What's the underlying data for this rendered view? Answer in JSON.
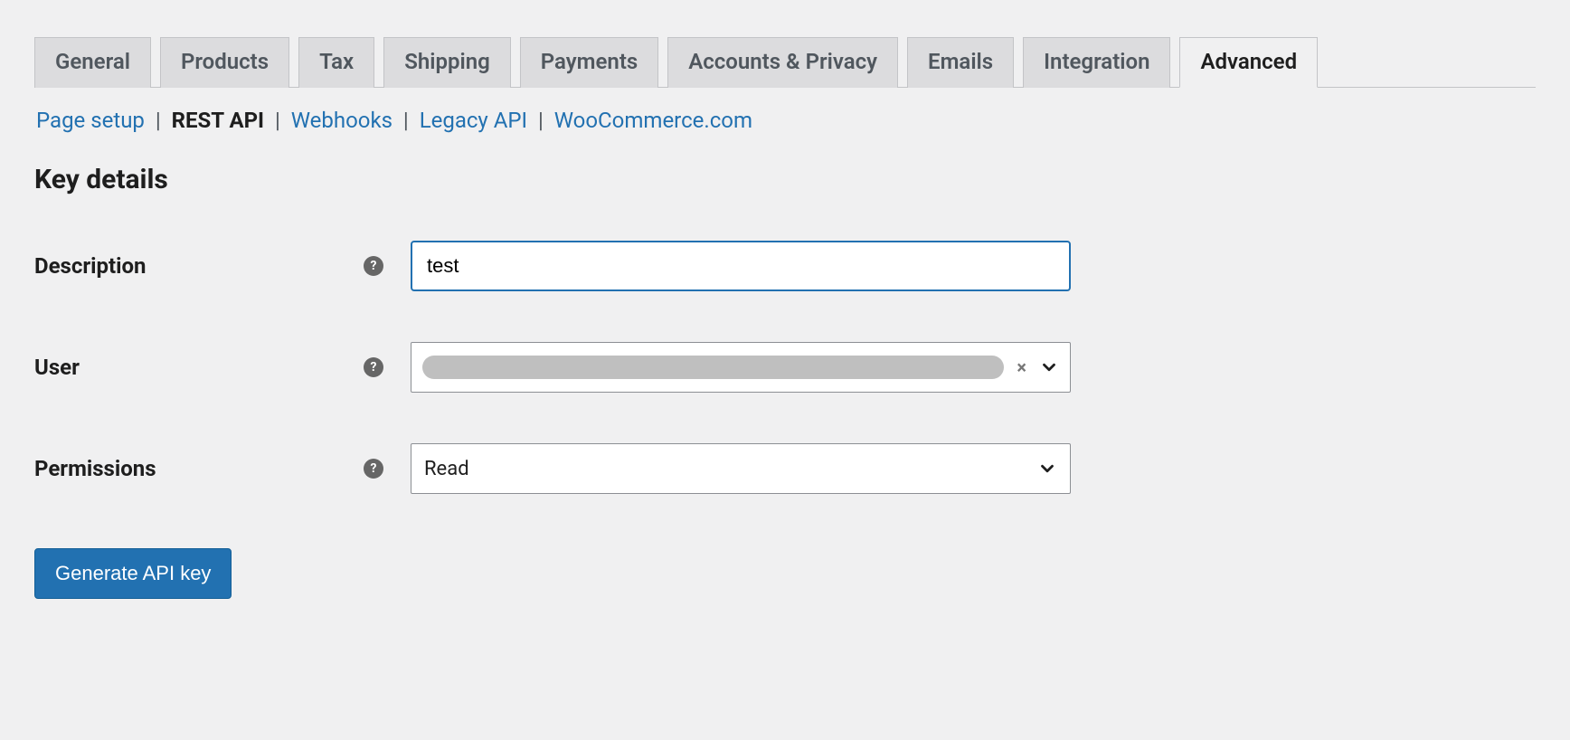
{
  "tabs": [
    {
      "label": "General",
      "active": false
    },
    {
      "label": "Products",
      "active": false
    },
    {
      "label": "Tax",
      "active": false
    },
    {
      "label": "Shipping",
      "active": false
    },
    {
      "label": "Payments",
      "active": false
    },
    {
      "label": "Accounts & Privacy",
      "active": false
    },
    {
      "label": "Emails",
      "active": false
    },
    {
      "label": "Integration",
      "active": false
    },
    {
      "label": "Advanced",
      "active": true
    }
  ],
  "subnav": [
    {
      "label": "Page setup",
      "current": false
    },
    {
      "label": "REST API",
      "current": true
    },
    {
      "label": "Webhooks",
      "current": false
    },
    {
      "label": "Legacy API",
      "current": false
    },
    {
      "label": "WooCommerce.com",
      "current": false
    }
  ],
  "section_title": "Key details",
  "form": {
    "description": {
      "label": "Description",
      "value": "test"
    },
    "user": {
      "label": "User",
      "selected_display": ""
    },
    "permissions": {
      "label": "Permissions",
      "value": "Read"
    }
  },
  "buttons": {
    "generate": "Generate API key"
  },
  "help_glyph": "?"
}
